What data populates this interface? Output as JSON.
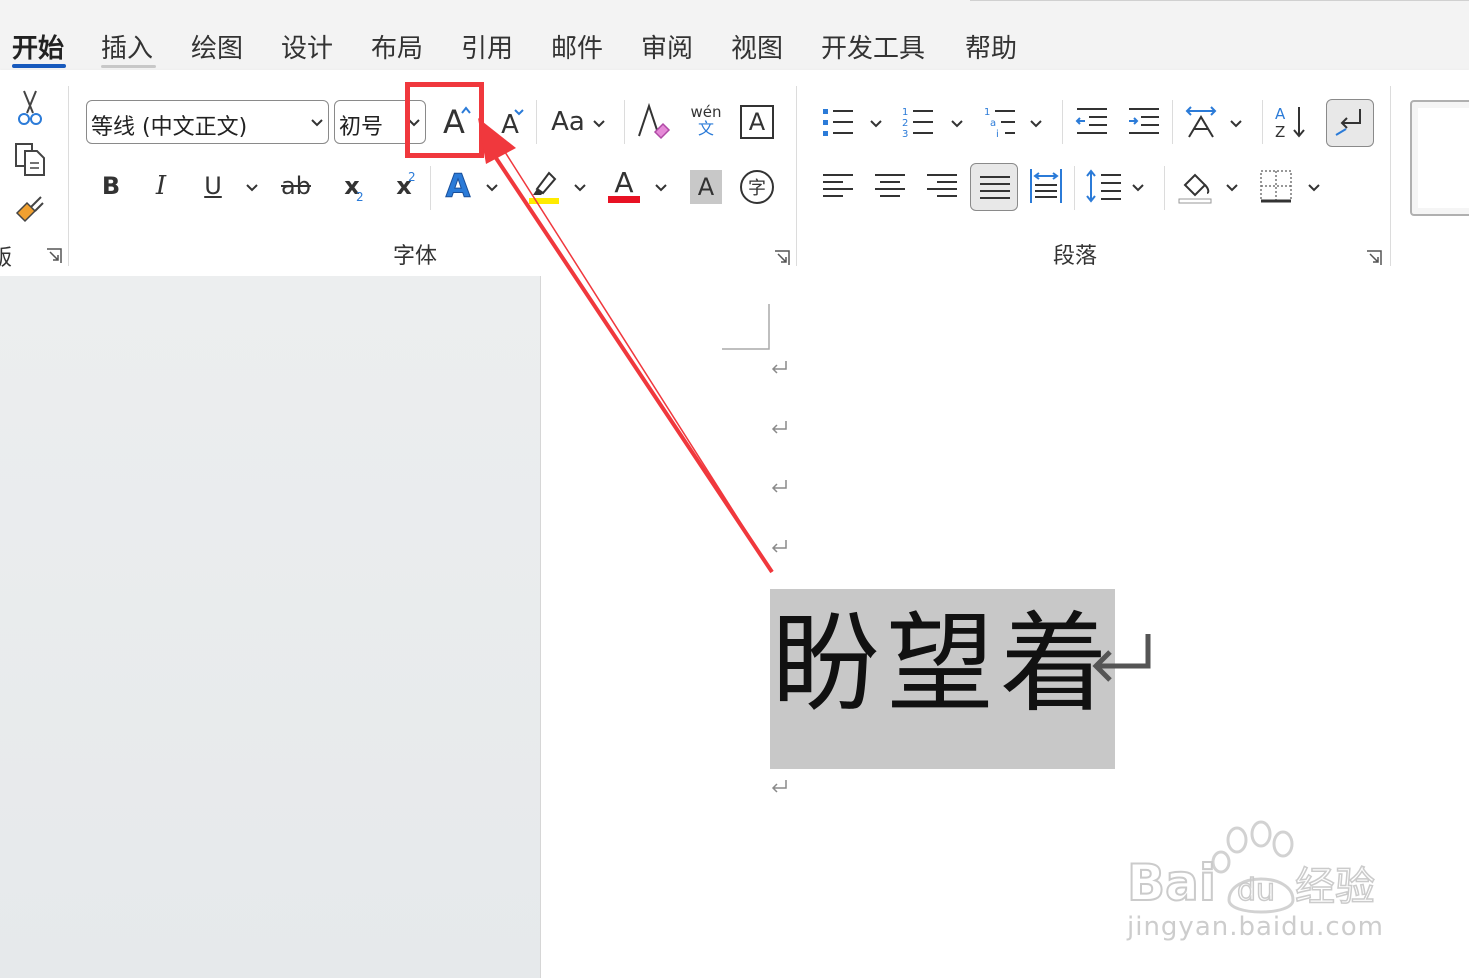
{
  "tabs": {
    "home": "开始",
    "insert": "插入",
    "draw": "绘图",
    "design": "设计",
    "layout": "布局",
    "references": "引用",
    "mailings": "邮件",
    "review": "审阅",
    "view": "视图",
    "developer": "开发工具",
    "help": "帮助"
  },
  "clipboard": {
    "label_partial": "贩"
  },
  "font": {
    "name": "等线 (中文正文)",
    "size": "初号",
    "group_label": "字体",
    "bold": "B",
    "italic": "I",
    "underline": "U",
    "strike": "ab",
    "subscript": "x",
    "superscript": "x",
    "change_case": "Aa",
    "phonetic_top": "wén",
    "phonetic_bottom": "文",
    "border_char": "A",
    "shade_char": "A",
    "enclose_char": "字",
    "grow": "A",
    "shrink": "A",
    "color_char": "A"
  },
  "paragraph": {
    "group_label": "段落"
  },
  "document": {
    "text": "盼望着"
  },
  "watermark": {
    "logo": "Bai du 经验",
    "url": "jingyan.baidu.com"
  },
  "colors": {
    "tab_active_underline": "#185abd",
    "annotation_red": "#f0383d",
    "highlight_yellow": "#ffeb00",
    "font_color_red": "#e81123",
    "selection_gray": "#c8c8c8"
  }
}
